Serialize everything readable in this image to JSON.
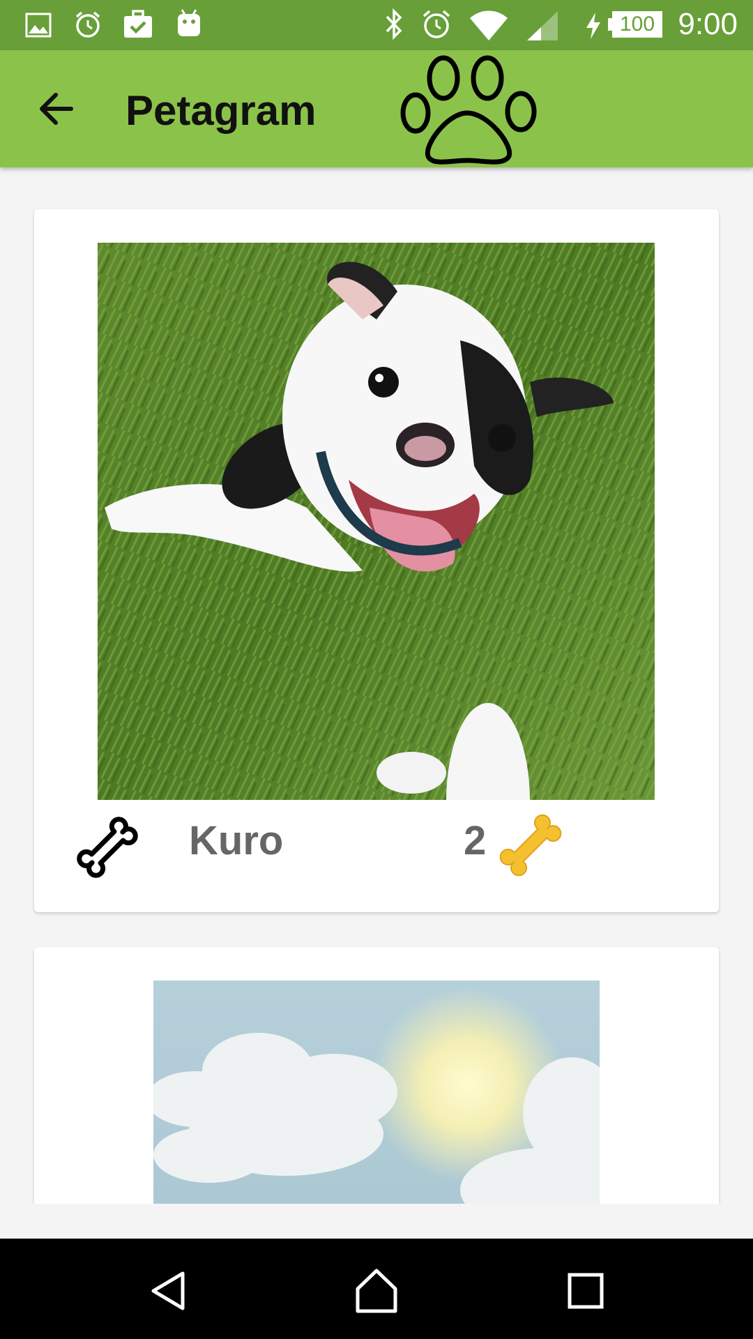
{
  "status_bar": {
    "time": "9:00",
    "battery": "100",
    "left_icons": [
      "gallery-icon",
      "alarm-icon",
      "briefcase-check-icon",
      "android-icon"
    ],
    "right_icons": [
      "bluetooth-icon",
      "alarm-icon",
      "wifi-icon",
      "signal-icon",
      "charging-icon",
      "battery-icon"
    ]
  },
  "app_bar": {
    "title": "Petagram",
    "back_icon": "arrow-back-icon",
    "logo_icon": "paw-icon"
  },
  "cards": [
    {
      "name": "Kuro",
      "likes": "2",
      "photo": "bulldog-puppy-on-grass",
      "rate_icon": "bone-outline-icon",
      "likes_icon": "bone-yellow-icon"
    },
    {
      "photo": "sky-clouds-sun"
    }
  ],
  "nav_bar": {
    "icons": [
      "back-triangle-icon",
      "home-icon",
      "recents-square-icon"
    ]
  },
  "colors": {
    "status_bar": "#689f38",
    "app_bar": "#8bc34a",
    "background": "#f4f4f4",
    "card": "#ffffff",
    "name_text": "#666666",
    "bone_yellow": "#f5c030"
  }
}
